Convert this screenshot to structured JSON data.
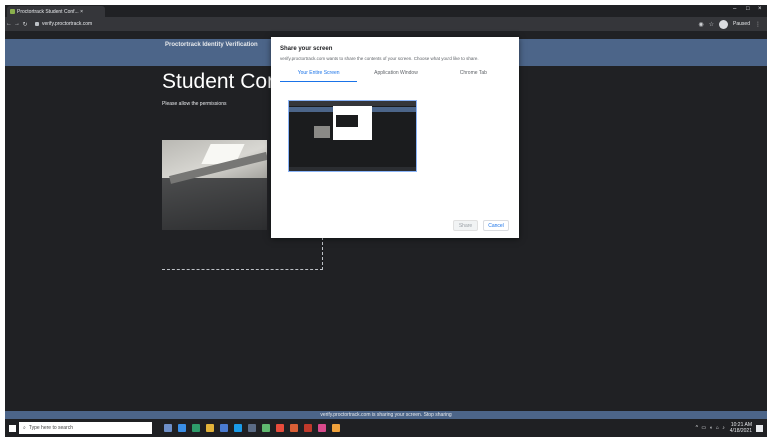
{
  "browser": {
    "tab_title": "Proctortrack Student Conf... ×",
    "url": "verify.proctortrack.com",
    "profile_name": "Paused"
  },
  "page": {
    "site_title": "Proctortrack Identity Verification",
    "heading": "Student Con",
    "subtext": "Please allow the permissions"
  },
  "dialog": {
    "title": "Share your screen",
    "description": "verify.proctortrack.com wants to share the contents of your screen. Choose what you'd like to share.",
    "tabs": [
      {
        "label": "Your Entire Screen",
        "active": true
      },
      {
        "label": "Application Window",
        "active": false
      },
      {
        "label": "Chrome Tab",
        "active": false
      }
    ],
    "share_button": "Share",
    "cancel_button": "Cancel"
  },
  "share_notice": "verify.proctortrack.com is sharing your screen.   Stop sharing",
  "taskbar": {
    "search_placeholder": "Type here to search",
    "time": "10:21 AM",
    "date": "4/18/2021",
    "icon_colors": [
      "#6d8fc9",
      "#3a8ee6",
      "#2e9c6a",
      "#e2b33a",
      "#4a7bd1",
      "#1a9be8",
      "#5b6c86",
      "#5fb86f",
      "#e74c3c",
      "#d95f36",
      "#c0392b",
      "#d94a8c",
      "#f0a23c"
    ]
  }
}
